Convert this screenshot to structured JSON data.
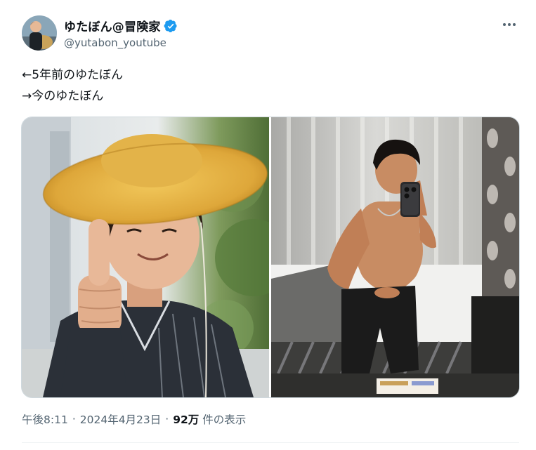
{
  "author": {
    "display_name": "ゆたぼん@冒険家",
    "handle": "@yutabon_youtube",
    "verified": true
  },
  "tweet": {
    "lines": [
      "←5年前のゆたぼん",
      "→今のゆたぼん"
    ]
  },
  "media": [
    {
      "kind": "photo",
      "subject": "child-with-straw-hat-thumbs-up"
    },
    {
      "kind": "photo",
      "subject": "mirror-selfie-in-hotel-room"
    }
  ],
  "meta": {
    "time": "午後8:11",
    "separator": "·",
    "date": "2024年4月23日",
    "views_count": "92万",
    "views_label": "件の表示"
  },
  "colors": {
    "text_primary": "#0f1419",
    "text_secondary": "#536471",
    "verified_blue": "#1d9bf0",
    "border": "#cfd9de"
  },
  "icons": {
    "verified": "verified-badge-icon",
    "more": "more-options-icon"
  }
}
